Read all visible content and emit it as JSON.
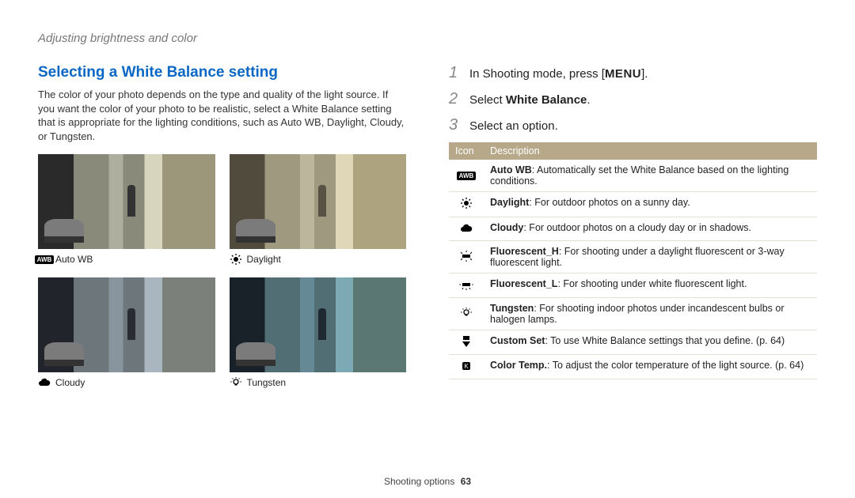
{
  "breadcrumb": "Adjusting brightness and color",
  "heading": "Selecting a White Balance setting",
  "intro": "The color of your photo depends on the type and quality of the light source. If you want the color of your photo to be realistic, select a White Balance setting that is appropriate for the lighting conditions, such as Auto WB, Daylight, Cloudy, or Tungsten.",
  "thumbs": {
    "autowb": "Auto WB",
    "daylight": "Daylight",
    "cloudy": "Cloudy",
    "tungsten": "Tungsten"
  },
  "steps": {
    "s1_pre": "In Shooting mode, press [",
    "s1_chip": "MENU",
    "s1_post": "].",
    "s2_pre": "Select ",
    "s2_bold": "White Balance",
    "s2_post": ".",
    "s3": "Select an option."
  },
  "table": {
    "h_icon": "Icon",
    "h_desc": "Description",
    "rows": {
      "autowb": {
        "b": "Auto WB",
        "t": ": Automatically set the White Balance based on the lighting conditions."
      },
      "daylight": {
        "b": "Daylight",
        "t": ": For outdoor photos on a sunny day."
      },
      "cloudy": {
        "b": "Cloudy",
        "t": ": For outdoor photos on a cloudy day or in shadows."
      },
      "fluoh": {
        "b": "Fluorescent_H",
        "t": ": For shooting under a daylight fluorescent or 3-way fluorescent light."
      },
      "fluol": {
        "b": "Fluorescent_L",
        "t": ": For shooting under white fluorescent light."
      },
      "tungsten": {
        "b": "Tungsten",
        "t": ": For shooting indoor photos under incandescent bulbs or halogen lamps."
      },
      "custom": {
        "b": "Custom Set",
        "t": ": To use White Balance settings that you define. (p. 64)"
      },
      "colortemp": {
        "b": "Color Temp.",
        "t": ": To adjust the color temperature of the light source. (p. 64)"
      }
    }
  },
  "footer": {
    "section": "Shooting options",
    "page": "63"
  }
}
